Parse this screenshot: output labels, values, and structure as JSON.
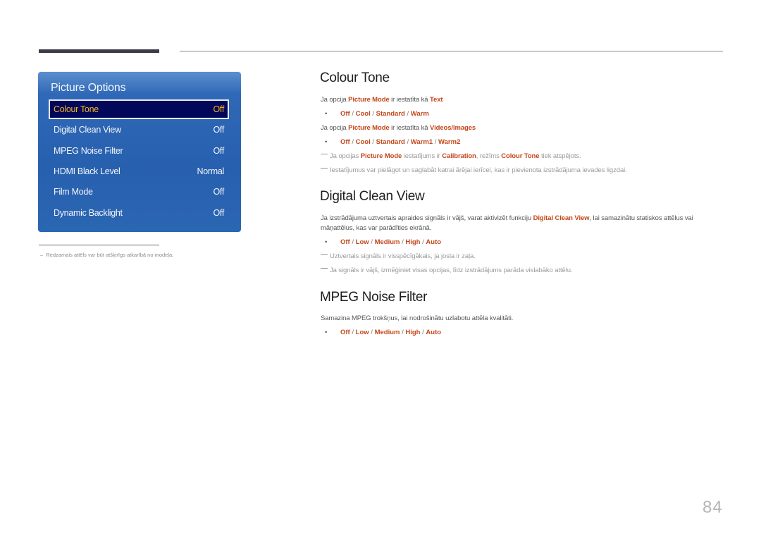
{
  "page_number": "84",
  "osd_menu": {
    "title": "Picture Options",
    "items": [
      {
        "label": "Colour Tone",
        "value": "Off",
        "selected": true
      },
      {
        "label": "Digital Clean View",
        "value": "Off",
        "selected": false
      },
      {
        "label": "MPEG Noise Filter",
        "value": "Off",
        "selected": false
      },
      {
        "label": "HDMI Black Level",
        "value": "Normal",
        "selected": false
      },
      {
        "label": "Film Mode",
        "value": "Off",
        "selected": false
      },
      {
        "label": "Dynamic Backlight",
        "value": "Off",
        "selected": false
      }
    ]
  },
  "footnote": "Redzamais attēls var būt atšķirīgs atkarībā no modeļa.",
  "sections": {
    "colour_tone": {
      "title": "Colour Tone",
      "line1": {
        "pre": "Ja opcija ",
        "hl1": "Picture Mode",
        "mid": " ir iestatīta kā ",
        "hl2": "Text"
      },
      "opts1": [
        "Off",
        "Cool",
        "Standard",
        "Warm"
      ],
      "line2": {
        "pre": "Ja opcija ",
        "hl1": "Picture Mode",
        "mid": " ir iestatīta kā ",
        "hl2": "Videos/Images"
      },
      "opts2": [
        "Off",
        "Cool",
        "Standard",
        "Warm1",
        "Warm2"
      ],
      "note1": {
        "pre": "Ja opcijas ",
        "hl1": "Picture Mode",
        "mid1": " iestatījums ir ",
        "hl2": "Calibration",
        "mid2": ", režīms ",
        "hl3": "Colour Tone",
        "post": " tiek atspējots."
      },
      "note2": "Iestatījumus var pielāgot un saglabāt katrai ārējai ierīcei, kas ir pievienota izstrādājuma ievades ligzdai."
    },
    "digital_clean_view": {
      "title": "Digital Clean View",
      "body": {
        "pre": "Ja izstrādājuma uztvertais apraides signāls ir vājš, varat aktivizēt funkciju ",
        "hl": "Digital Clean View",
        "post": ", lai samazinātu statiskos attēlus vai",
        "line2": "māņattēlus, kas var parādīties ekrānā."
      },
      "opts": [
        "Off",
        "Low",
        "Medium",
        "High",
        "Auto"
      ],
      "note1": "Uztvertais signāls ir visspēcīgākais, ja josla ir zaļa.",
      "note2": "Ja signāls ir vājš, izmēģiniet visas opcijas, līdz izstrādājums parāda vislabāko attēlu."
    },
    "mpeg_noise_filter": {
      "title": "MPEG Noise Filter",
      "body": "Samazina MPEG trokšņus, lai nodrošinātu uzlabotu attēla kvalitāti.",
      "opts": [
        "Off",
        "Low",
        "Medium",
        "High",
        "Auto"
      ]
    }
  },
  "colors": {
    "highlight": "#c4461b",
    "osd_blue": "#2760ae",
    "osd_selected_bg": "#02075a",
    "osd_selected_text": "#f6b621"
  }
}
